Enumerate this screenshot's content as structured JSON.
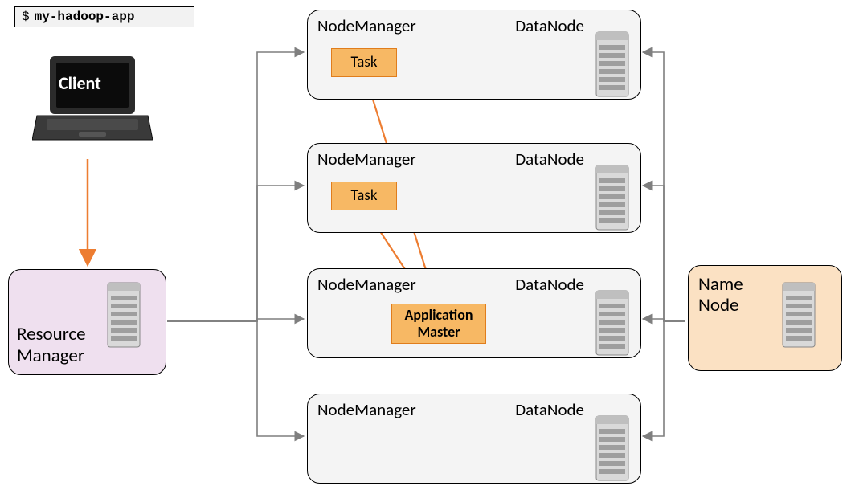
{
  "command": {
    "prompt": "$",
    "text": "my-hadoop-app"
  },
  "client": {
    "label": "Client"
  },
  "resource_manager": {
    "line1": "Resource",
    "line2": "Manager"
  },
  "name_node": {
    "line1": "Name",
    "line2": "Node"
  },
  "nodes": [
    {
      "nm_label": "NodeManager",
      "dn_label": "DataNode",
      "task": "Task"
    },
    {
      "nm_label": "NodeManager",
      "dn_label": "DataNode",
      "task": "Task"
    },
    {
      "nm_label": "NodeManager",
      "dn_label": "DataNode",
      "app_master": "Application Master"
    },
    {
      "nm_label": "NodeManager",
      "dn_label": "DataNode"
    }
  ],
  "colors": {
    "orange_fill": "#f7b864",
    "orange_stroke": "#e07d1c",
    "orange_arrow": "#ed7d31",
    "rm_fill": "#efe0ef",
    "nn_fill": "#fbe1c3",
    "nm_fill": "#f4f4f4",
    "gray_arrow": "#7f7f7f"
  },
  "arrows": {
    "client_to_rm": true,
    "rm_to_nm": [
      1,
      2,
      3,
      4
    ],
    "nn_to_dn": [
      1,
      2,
      3,
      4
    ],
    "am_to_tasks": [
      1,
      2
    ]
  }
}
